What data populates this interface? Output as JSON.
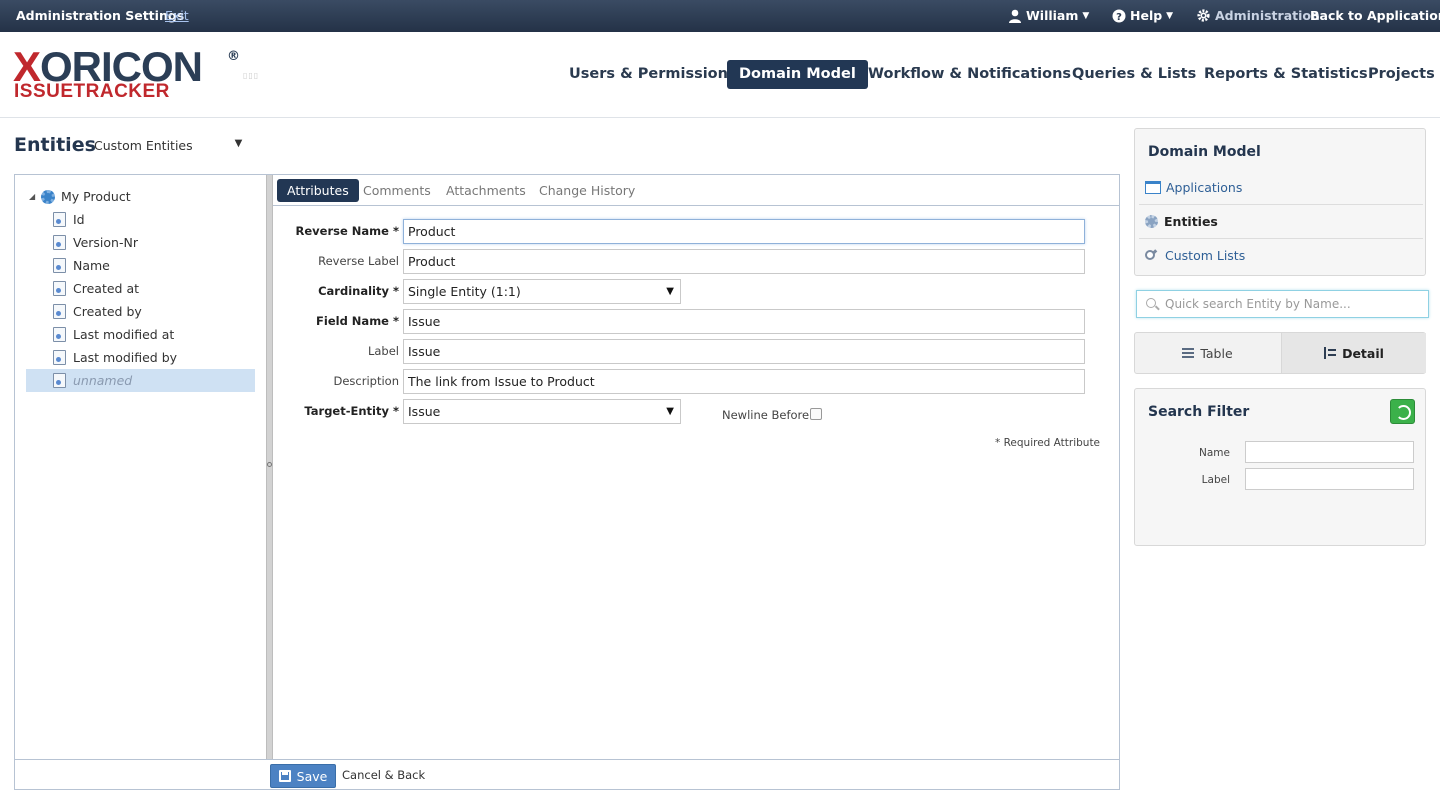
{
  "topbar": {
    "title": "Administration Settings",
    "exit": "Exit",
    "user": "William",
    "help": "Help",
    "admin": "Administration",
    "back": "Back to Application"
  },
  "logo": {
    "brand_x": "X",
    "brand_rest": "ORICON",
    "reg": "®",
    "sub": "ISSUETRACKER"
  },
  "nav": {
    "users": "Users & Permissions",
    "domain": "Domain Model",
    "workflow": "Workflow & Notifications",
    "queries": "Queries & Lists",
    "reports": "Reports & Statistics",
    "projects": "Projects"
  },
  "entities": {
    "title": "Entities",
    "filter": "Custom Entities"
  },
  "tree": {
    "root": "My Product",
    "items": [
      "Id",
      "Version-Nr",
      "Name",
      "Created at",
      "Created by",
      "Last modified at",
      "Last modified by"
    ],
    "selected": "unnamed"
  },
  "tabs": {
    "attributes": "Attributes",
    "comments": "Comments",
    "attachments": "Attachments",
    "history": "Change History"
  },
  "form": {
    "reverse_name_label": "Reverse Name *",
    "reverse_name": "Product",
    "reverse_label_label": "Reverse Label",
    "reverse_label": "Product",
    "cardinality_label": "Cardinality *",
    "cardinality": "Single Entity (1:1)",
    "field_name_label": "Field Name *",
    "field_name": "Issue",
    "label_label": "Label",
    "label": "Issue",
    "description_label": "Description",
    "description": "The link from Issue to Product",
    "target_label": "Target-Entity *",
    "target": "Issue",
    "newline_label": "Newline Before",
    "required_note": "* Required Attribute"
  },
  "footer": {
    "save": "Save",
    "cancel": "Cancel & Back"
  },
  "sidebar": {
    "title": "Domain Model",
    "applications": "Applications",
    "entities": "Entities",
    "custom_lists": "Custom Lists",
    "search_placeholder": "Quick search Entity by Name...",
    "table": "Table",
    "detail": "Detail",
    "filter_title": "Search Filter",
    "filter_name": "Name",
    "filter_label": "Label"
  }
}
